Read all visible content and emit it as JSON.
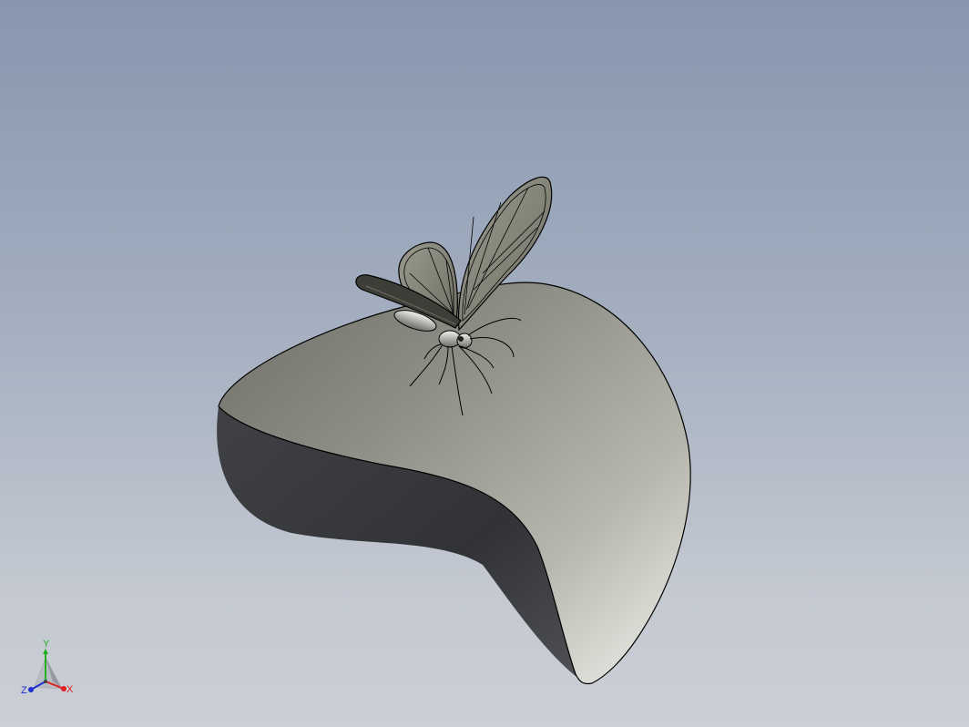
{
  "viewport": {
    "background_top": "#8796ae",
    "background_bottom": "#cbcfd6"
  },
  "model": {
    "leaf_color": "#8e8e86",
    "butterfly_color": "#8a8a7c",
    "outline_color": "#000000"
  },
  "triad": {
    "x_label": "X",
    "y_label": "Y",
    "z_label": "Z",
    "x_color": "#e02020",
    "y_color": "#20b020",
    "z_color": "#2030d0"
  }
}
